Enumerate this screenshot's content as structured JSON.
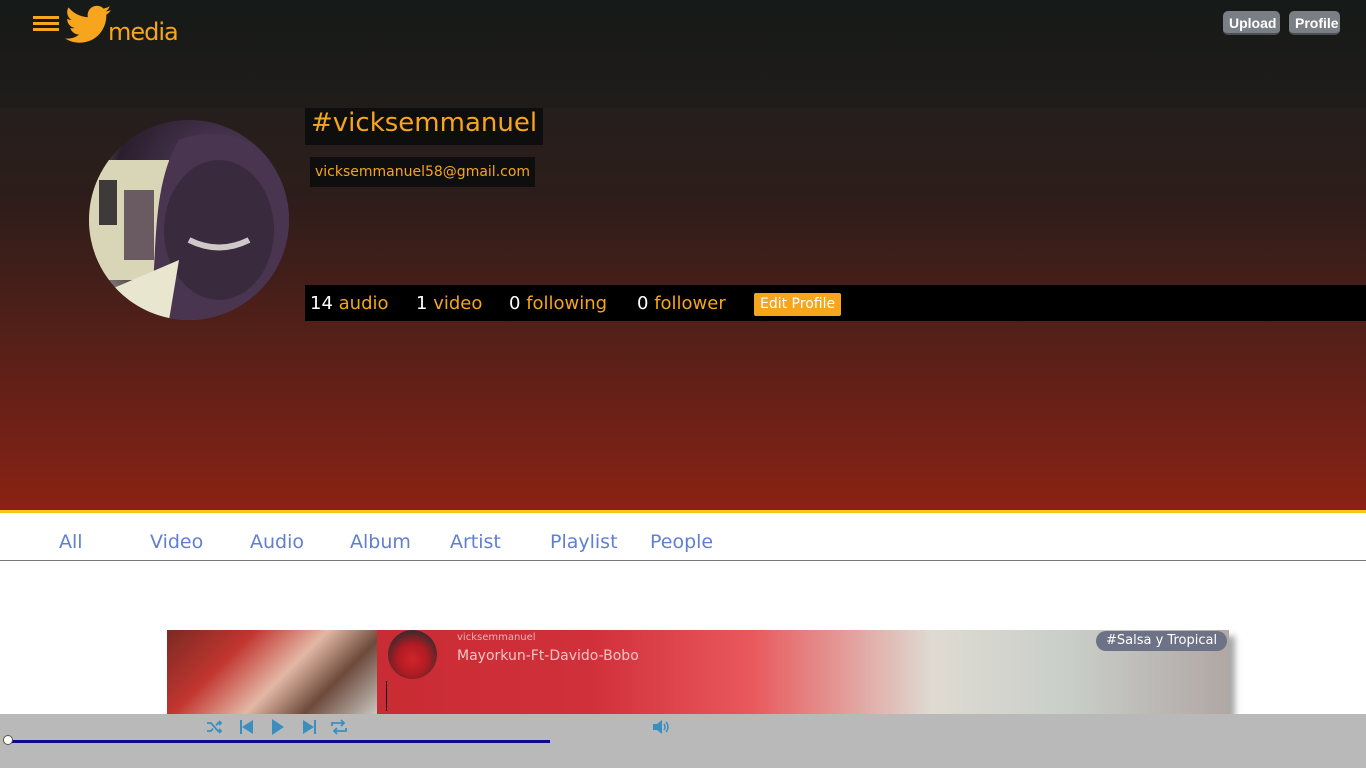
{
  "header": {
    "logo_text": "media",
    "upload_label": "Upload",
    "profile_label": "Profile"
  },
  "profile": {
    "username": "#vicksemmanuel",
    "email": "vicksemmanuel58@gmail.com",
    "stats": {
      "audio_count": "14",
      "audio_label": "audio",
      "video_count": "1",
      "video_label": "video",
      "following_count": "0",
      "following_label": "following",
      "follower_count": "0",
      "follower_label": "follower"
    },
    "edit_label": "Edit Profile"
  },
  "tabs": [
    "All",
    "Video",
    "Audio",
    "Album",
    "Artist",
    "Playlist",
    "People"
  ],
  "track": {
    "artist": "vicksemmanuel",
    "title": "Mayorkun-Ft-Davido-Bobo",
    "genre": "#Salsa y Tropical"
  },
  "player": {
    "progress": 0
  },
  "colors": {
    "accent": "#f7a51c",
    "tab_text": "#5f7fd3",
    "progress": "#0a0a8c"
  }
}
